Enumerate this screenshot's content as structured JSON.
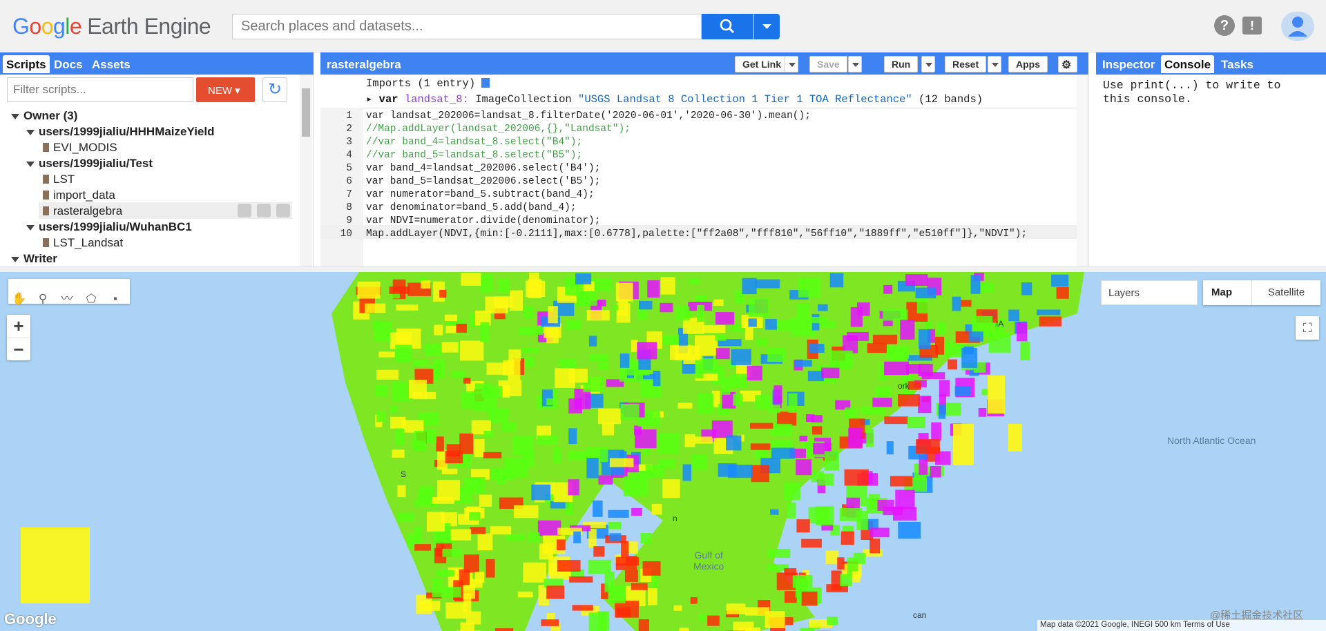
{
  "header": {
    "logo_google": [
      "G",
      "o",
      "o",
      "g",
      "l",
      "e"
    ],
    "logo_product": "Earth Engine",
    "search_placeholder": "Search places and datasets..."
  },
  "left_panel": {
    "tabs": [
      "Scripts",
      "Docs",
      "Assets"
    ],
    "filter_placeholder": "Filter scripts...",
    "new_label": "NEW",
    "tree": [
      {
        "label": "Owner (3)",
        "type": "folder",
        "level": 0
      },
      {
        "label": "users/1999jialiu/HHHMaizeYield",
        "type": "folder",
        "level": 1
      },
      {
        "label": "EVI_MODIS",
        "type": "file",
        "level": 2
      },
      {
        "label": "users/1999jialiu/Test",
        "type": "folder",
        "level": 1
      },
      {
        "label": "LST",
        "type": "file",
        "level": 2
      },
      {
        "label": "import_data",
        "type": "file",
        "level": 2
      },
      {
        "label": "rasteralgebra",
        "type": "file",
        "level": 2
      },
      {
        "label": "users/1999jialiu/WuhanBC1",
        "type": "folder",
        "level": 1
      },
      {
        "label": "LST_Landsat",
        "type": "file",
        "level": 2
      },
      {
        "label": "Writer",
        "type": "folder",
        "level": 0
      }
    ]
  },
  "editor": {
    "title": "rasteralgebra",
    "buttons": {
      "get_link": "Get Link",
      "save": "Save",
      "run": "Run",
      "reset": "Reset",
      "apps": "Apps"
    },
    "imports_line": "Imports (1 entry)",
    "import_var": "var",
    "import_name": "landsat_8:",
    "import_type": "ImageCollection",
    "import_desc": "\"USGS Landsat 8 Collection 1 Tier 1 TOA Reflectance\"",
    "import_bands": "(12 bands)",
    "line_numbers": [
      "1",
      "2",
      "3",
      "4",
      "5",
      "6",
      "7",
      "8",
      "9",
      "10"
    ],
    "code": [
      "var landsat_202006=landsat_8.filterDate('2020-06-01','2020-06-30').mean();",
      "//Map.addLayer(landsat_202006,{},\"Landsat\");",
      "//var band_4=landsat_8.select(\"B4\");",
      "//var band_5=landsat_8.select(\"B5\");",
      "var band_4=landsat_202006.select('B4');",
      "var band_5=landsat_202006.select('B5');",
      "var numerator=band_5.subtract(band_4);",
      "var denominator=band_5.add(band_4);",
      "var NDVI=numerator.divide(denominator);",
      "Map.addLayer(NDVI,{min:[-0.2111],max:[0.6778],palette:[\"ff2a08\",\"fff810\",\"56ff10\",\"1889ff\",\"e510ff\"]},\"NDVI\");"
    ]
  },
  "right_panel": {
    "tabs": [
      "Inspector",
      "Console",
      "Tasks"
    ],
    "console_text": "Use print(...) to write to\nthis console."
  },
  "map": {
    "layers_label": "Layers",
    "map_type": [
      "Map",
      "Satellite"
    ],
    "zoom_in": "+",
    "zoom_out": "−",
    "ocean_atlantic": "North\nAtlantic\nOcean",
    "ocean_gulf": "Gulf of\nMexico",
    "attribution": "Map data ©2021 Google, INEGI   500 km   Terms of Use",
    "google": "Google",
    "watermark": "@稀土掘金技术社区",
    "city_labels": [
      "ork",
      "IA",
      "S",
      "n",
      "can"
    ],
    "ndvi_palette": [
      "#ff2a08",
      "#fff810",
      "#56ff10",
      "#1889ff",
      "#e510ff"
    ]
  }
}
